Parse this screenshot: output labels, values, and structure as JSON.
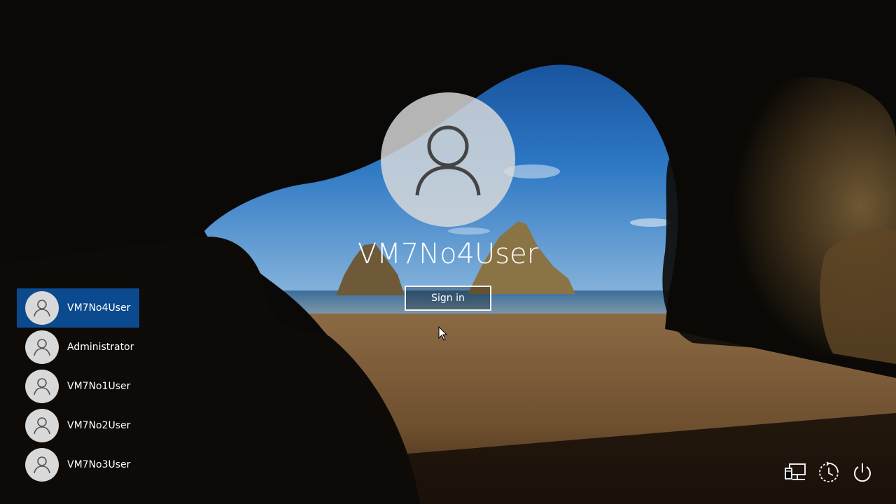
{
  "lock_screen": {
    "current_user": "VM7No4User",
    "sign_in_label": "Sign in"
  },
  "user_list": [
    {
      "name": "VM7No4User",
      "selected": true
    },
    {
      "name": "Administrator",
      "selected": false
    },
    {
      "name": "VM7No1User",
      "selected": false
    },
    {
      "name": "VM7No2User",
      "selected": false
    },
    {
      "name": "VM7No3User",
      "selected": false
    }
  ],
  "system_icons": [
    "network-icon",
    "ease-of-access-icon",
    "power-icon"
  ],
  "colors": {
    "selected_user_bg": "#0b4a8f",
    "text": "#ffffff",
    "avatar_bg": "#d9d9d9"
  }
}
